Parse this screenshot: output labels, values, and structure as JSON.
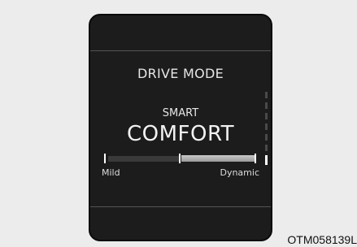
{
  "display": {
    "title": "DRIVE MODE",
    "submode": "SMART",
    "mode": "COMFORT",
    "scale": {
      "left_label": "Mild",
      "right_label": "Dynamic"
    }
  },
  "figure_code": "OTM058139L"
}
